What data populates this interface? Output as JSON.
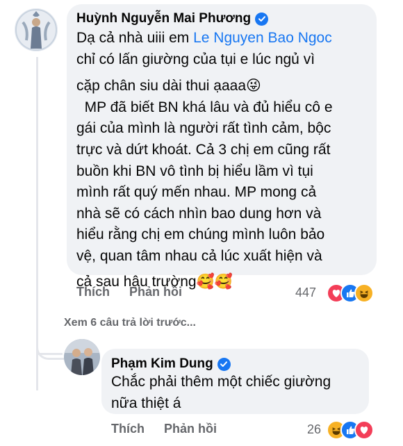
{
  "comments": [
    {
      "author": "Huỳnh Nguyễn Mai Phương",
      "verified": true,
      "text_before_mention": "Dạ cả nhà uiii em ",
      "mention": "Le Nguyen Bao Ngoc",
      "text_lines": [
        "chỉ có lấn giường của tụi e lúc ngủ vì",
        "cặp chân siu dài thui ạaaa😜",
        "  MP đã biết BN khá lâu và đủ hiểu cô e",
        "gái của mình là người rất tình cảm, bộc",
        "trực và dứt khoát. Cả 3 chị em cũng rất",
        "buồn khi BN vô tình bị hiểu lầm vì tụi",
        "mình rất quý mến nhau. MP mong cả",
        "nhà sẽ có cách nhìn bao dung hơn và",
        "hiểu rằng chị em chúng mình luôn bảo",
        "vệ, quan tâm nhau cả lúc xuất hiện và",
        "cả sau hậu trường🥰🥰"
      ],
      "like_label": "Thích",
      "reply_label": "Phản hồi",
      "reaction_count": "447",
      "reactions": [
        "love",
        "like",
        "haha"
      ]
    },
    {
      "author": "Phạm Kim Dung",
      "verified": true,
      "text_lines": [
        "Chắc phải thêm một chiếc giường",
        "nữa thiệt á"
      ],
      "like_label": "Thích",
      "reply_label": "Phản hồi",
      "reaction_count": "26",
      "reactions": [
        "haha",
        "like",
        "love"
      ]
    }
  ],
  "view_previous_replies": "Xem 6 câu trả lời trước...",
  "colors": {
    "bubble": "#f0f2f5",
    "mention": "#1877f2",
    "meta": "#65676b",
    "love": "#f33e58",
    "like": "#1877f2",
    "haha": "#f7b125"
  }
}
